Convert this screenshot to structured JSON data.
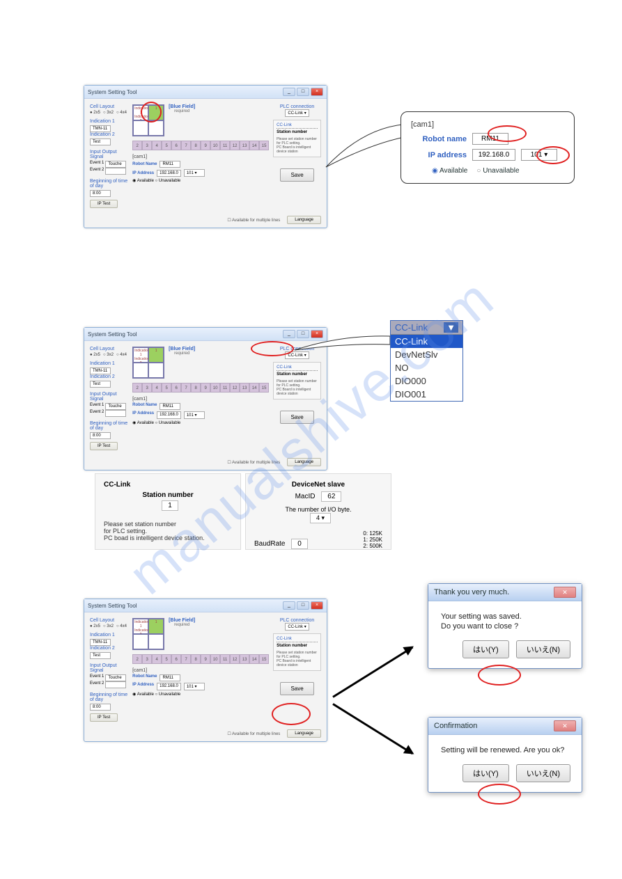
{
  "watermark": "manualshive.com",
  "app": {
    "title": "System Setting Tool",
    "blue_field": "[Blue Field]",
    "required": "required",
    "cell_layout": "Cell Layout",
    "layout_opts": [
      "2x5",
      "3x2",
      "4x4"
    ],
    "indication1": "Indication 1",
    "indication1_val": "TMN-11",
    "indication2": "Indication 2",
    "indication2_val": "Test",
    "io_signal": "Input Output Signal",
    "event1": "Event 1",
    "event1_val": "Touche",
    "event2": "Event 2",
    "begin_day": "Beginning of time of day",
    "begin_val": "8:00",
    "iptest": "IP Test",
    "cam1": "[cam1]",
    "robot_name_lbl": "Robot Name",
    "robot_name_val": "RM11",
    "ip_addr_lbl": "IP Address",
    "ip_addr_val": "192.168.0",
    "ip_oct": "101",
    "available": "Available",
    "unavailable": "Unavailable",
    "save": "Save",
    "plc_conn": "PLC connection",
    "plc_val": "CC-Link",
    "cclink_hdr": "CC-Link",
    "station_num": "Station number",
    "cclink_note1": "Please set station number",
    "cclink_note2": "for PLC setting.",
    "cclink_note3": "PC Board is intelligent device station",
    "multi_lines": "Available for multiple lines",
    "language": "Language",
    "nums": [
      "2",
      "3",
      "4",
      "5",
      "6",
      "7",
      "8",
      "9",
      "10",
      "11",
      "12",
      "13",
      "14",
      "15"
    ],
    "grid_lbl1": "Indication 1",
    "grid_lbl2": "Indication 2",
    "grid_num": "1"
  },
  "callout1": {
    "cam1": "[cam1]",
    "robot_name": "Robot name",
    "robot_val": "RM11",
    "ip_addr": "IP address",
    "ip_val": "192.168.0",
    "ip_oct": "101",
    "available": "Available",
    "unavailable": "Unavailable"
  },
  "dropdown": {
    "selected": "CC-Link",
    "items": [
      "CC-Link",
      "DevNetSlv",
      "NO",
      "DIO000",
      "DIO001"
    ]
  },
  "panel_left": {
    "title": "CC-Link",
    "station": "Station number",
    "station_val": "1",
    "note1": "Please set station number",
    "note2": "for PLC setting.",
    "note3": "PC boad is intelligent device station."
  },
  "panel_right": {
    "title": "DeviceNet slave",
    "macid": "MacID",
    "macid_val": "62",
    "iobyte": "The number of I/O byte.",
    "iobyte_val": "4",
    "baud": "BaudRate",
    "baud_val": "0",
    "r0": "0: 125K",
    "r1": "1: 250K",
    "r2": "2: 500K"
  },
  "dialog1": {
    "title": "Thank you very much.",
    "line1": "Your setting was saved.",
    "line2": "Do you want to close ?",
    "yes": "はい(Y)",
    "no": "いいえ(N)"
  },
  "dialog2": {
    "title": "Confirmation",
    "line1": "Setting will be renewed. Are you ok?",
    "yes": "はい(Y)",
    "no": "いいえ(N)"
  }
}
